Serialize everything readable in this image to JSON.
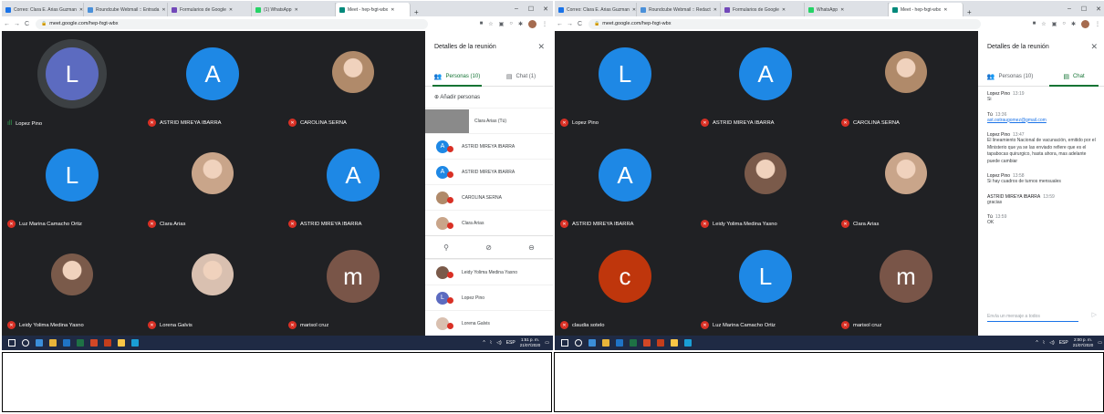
{
  "left": {
    "tabs": [
      {
        "label": "Correo: Clara E. Arias Guzman",
        "color": "#1a73e8"
      },
      {
        "label": "Roundcube Webmail :: Entrada",
        "color": "#4a90d9"
      },
      {
        "label": "Formularios de Google",
        "color": "#7248b9"
      },
      {
        "label": "(1) WhatsApp",
        "color": "#25d366"
      },
      {
        "label": "Meet - hep-fxgt-wbx",
        "color": "#00897b"
      }
    ],
    "url": "meet.google.com/hep-fxgt-wbx",
    "tiles": [
      {
        "name": "Lopez Pino",
        "initial": "L",
        "color": "#5c6bc0",
        "kind": "letter",
        "ring": true,
        "mic": "on"
      },
      {
        "name": "ASTRID MIREYA IBARRA",
        "initial": "A",
        "color": "#1e88e5",
        "kind": "letter",
        "mic": "off"
      },
      {
        "name": "CAROLINA SERNA",
        "kind": "photo",
        "color": "#b08a6a",
        "mic": "off"
      },
      {
        "name": "Luz Marina Camacho Ortiz",
        "initial": "L",
        "color": "#1e88e5",
        "kind": "letter",
        "mic": "off"
      },
      {
        "name": "Clara Arias",
        "kind": "photo",
        "color": "#c9a58a",
        "mic": "off"
      },
      {
        "name": "ASTRID MIREYA IBARRA",
        "initial": "A",
        "color": "#1e88e5",
        "kind": "letter",
        "mic": "off"
      },
      {
        "name": "Leidy Yolima Medina Yasno",
        "kind": "photo",
        "color": "#7a5a4a",
        "mic": "off"
      },
      {
        "name": "Lorena Galvis",
        "kind": "photo",
        "color": "#d9c0b0",
        "mic": "off"
      },
      {
        "name": "marisol cruz",
        "initial": "m",
        "color": "#795548",
        "kind": "letter",
        "mic": "off"
      }
    ],
    "panel": {
      "title": "Detalles de la reunión",
      "tab_people": "Personas (10)",
      "tab_chat": "Chat (1)",
      "add": "Añadir personas",
      "people": [
        {
          "name": "Clara Arias (Tú)",
          "color": "#8a8a8a",
          "initial": ""
        },
        {
          "name": "ASTRID MIREYA IBARRA",
          "color": "#1e88e5",
          "initial": "A"
        },
        {
          "name": "ASTRID MIREYA IBARRA",
          "color": "#1e88e5",
          "initial": "A"
        },
        {
          "name": "CAROLINA SERNA",
          "color": "#b08a6a",
          "initial": ""
        },
        {
          "name": "Clara Arias",
          "color": "#c9a58a",
          "initial": ""
        }
      ],
      "people2": [
        {
          "name": "Leidy Yolima Medina Yasno",
          "color": "#7a5a4a",
          "initial": ""
        },
        {
          "name": "Lopez Pino",
          "color": "#5c6bc0",
          "initial": "L"
        },
        {
          "name": "Lorena Galvis",
          "color": "#d9c0b0",
          "initial": ""
        }
      ]
    },
    "clock": {
      "time": "1:51 p. m.",
      "date": "21/07/2020"
    },
    "lang": "ESP"
  },
  "right": {
    "tabs": [
      {
        "label": "Correo: Clara E. Arias Guzman",
        "color": "#1a73e8"
      },
      {
        "label": "Roundcube Webmail :: Redact",
        "color": "#4a90d9"
      },
      {
        "label": "Formularios de Google",
        "color": "#7248b9"
      },
      {
        "label": "WhatsApp",
        "color": "#25d366"
      },
      {
        "label": "Meet - hep-fxgt-wbx",
        "color": "#00897b"
      }
    ],
    "url": "meet.google.com/hep-fxgt-wbx",
    "tiles": [
      {
        "name": "Lopez Pino",
        "initial": "L",
        "color": "#1e88e5",
        "kind": "letter",
        "mic": "off"
      },
      {
        "name": "ASTRID MIREYA IBARRA",
        "initial": "A",
        "color": "#1e88e5",
        "kind": "letter",
        "mic": "off"
      },
      {
        "name": "CAROLINA SERNA",
        "kind": "photo",
        "color": "#b08a6a",
        "mic": "off"
      },
      {
        "name": "ASTRID MIREYA IBARRA",
        "initial": "A",
        "color": "#1e88e5",
        "kind": "letter",
        "mic": "off"
      },
      {
        "name": "Leidy Yolima Medina Yasno",
        "kind": "photo",
        "color": "#7a5a4a",
        "mic": "off"
      },
      {
        "name": "Clara Arias",
        "kind": "photo",
        "color": "#c9a58a",
        "mic": "off"
      },
      {
        "name": "claudia sotelo",
        "initial": "c",
        "color": "#bf360c",
        "kind": "letter",
        "mic": "off"
      },
      {
        "name": "Luz Marina Camacho Ortiz",
        "initial": "L",
        "color": "#1e88e5",
        "kind": "letter",
        "mic": "off"
      },
      {
        "name": "marisol cruz",
        "initial": "m",
        "color": "#795548",
        "kind": "letter",
        "mic": "off"
      }
    ],
    "panel": {
      "title": "Detalles de la reunión",
      "tab_people": "Personas (10)",
      "tab_chat": "Chat",
      "messages": [
        {
          "who": "Lopez Pino",
          "time": "13:19",
          "body": "Si",
          "link": false
        },
        {
          "who": "Tú",
          "time": "13:36",
          "body": "ast.ostraugomez@gmail.com",
          "link": true
        },
        {
          "who": "Lopez Pino",
          "time": "13:47",
          "body": "El lineamiento Nacional de vacunación, emitido por el Ministerio que ya se las enviado refiere que es el tapabocas quirurgico, hasta ahora, mas adelante puede cambiar",
          "link": false
        },
        {
          "who": "Lopez Pino",
          "time": "13:58",
          "body": "Si hay cuadros de turnos mensuales",
          "link": false
        },
        {
          "who": "ASTRID MIREYA IBARRA",
          "time": "13:59",
          "body": "gracias",
          "link": false
        },
        {
          "who": "Tú",
          "time": "13:59",
          "body": "OK",
          "link": false
        }
      ],
      "input_placeholder": "Envía un mensaje a todos"
    },
    "clock": {
      "time": "2:00 p. m.",
      "date": "21/07/2020"
    },
    "lang": "ESP"
  }
}
